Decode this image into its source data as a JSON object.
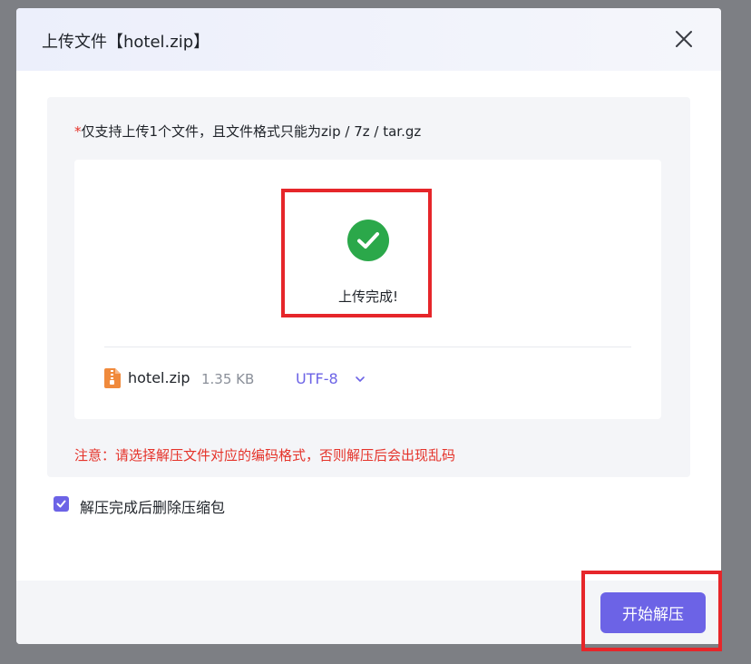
{
  "dialog": {
    "title": "上传文件【hotel.zip】",
    "close_icon": "close-icon"
  },
  "upload": {
    "required_mark": "*",
    "hint": "仅支持上传1个文件，且文件格式只能为zip / 7z / tar.gz",
    "status_icon": "check-circle-icon",
    "status_text": "上传完成!",
    "file": {
      "icon": "zip-file-icon",
      "name": "hotel.zip",
      "size": "1.35 KB"
    },
    "encoding": {
      "value": "UTF-8",
      "icon": "chevron-down-icon"
    },
    "warning": "注意：请选择解压文件对应的编码格式，否则解压后会出现乱码"
  },
  "options": {
    "delete_after_extract": {
      "checked": true,
      "label": "解压完成后删除压缩包"
    }
  },
  "footer": {
    "primary_label": "开始解压"
  },
  "colors": {
    "accent": "#6c63e6",
    "success": "#2ba84a",
    "danger": "#e5332a",
    "annotation": "#e6262a"
  }
}
